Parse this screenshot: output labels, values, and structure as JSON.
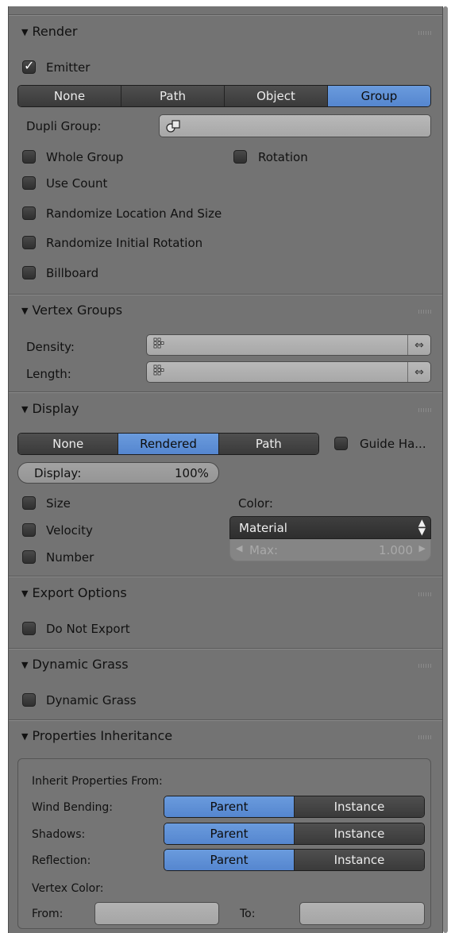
{
  "render": {
    "title": "Render",
    "emitter": "Emitter",
    "modes": [
      "None",
      "Path",
      "Object",
      "Group"
    ],
    "selected_mode": "Group",
    "dupli_group_label": "Dupli Group:",
    "dupli_group_value": "",
    "whole_group": "Whole Group",
    "rotation": "Rotation",
    "use_count": "Use Count",
    "randomize_location": "Randomize Location And Size",
    "randomize_rotation": "Randomize Initial Rotation",
    "billboard": "Billboard"
  },
  "vertex_groups": {
    "title": "Vertex Groups",
    "density_label": "Density:",
    "length_label": "Length:",
    "swap_glyph": "⇔"
  },
  "display": {
    "title": "Display",
    "modes": [
      "None",
      "Rendered",
      "Path"
    ],
    "selected_mode": "Rendered",
    "guide_hair": "Guide Ha...",
    "display_label": "Display:",
    "display_value": "100%",
    "display_fraction": 1.0,
    "size": "Size",
    "velocity": "Velocity",
    "number": "Number",
    "color_label": "Color:",
    "color_value": "Material",
    "max_label": "Max:",
    "max_value": "1.000"
  },
  "export": {
    "title": "Export Options",
    "do_not_export": "Do Not Export"
  },
  "dynamic_grass": {
    "title": "Dynamic Grass",
    "checkbox": "Dynamic Grass"
  },
  "inheritance": {
    "title": "Properties Inheritance",
    "inherit_from": "Inherit Properties From:",
    "rows": [
      {
        "label": "Wind Bending:",
        "options": [
          "Parent",
          "Instance"
        ],
        "selected": "Parent"
      },
      {
        "label": "Shadows:",
        "options": [
          "Parent",
          "Instance"
        ],
        "selected": "Parent"
      },
      {
        "label": "Reflection:",
        "options": [
          "Parent",
          "Instance"
        ],
        "selected": "Parent"
      }
    ],
    "vertex_color": "Vertex Color:",
    "from_label": "From:",
    "to_label": "To:"
  },
  "colors": {
    "panel_bg": "#737373",
    "selected_blue": "#5c8fd6",
    "button_dark": "#444444"
  }
}
